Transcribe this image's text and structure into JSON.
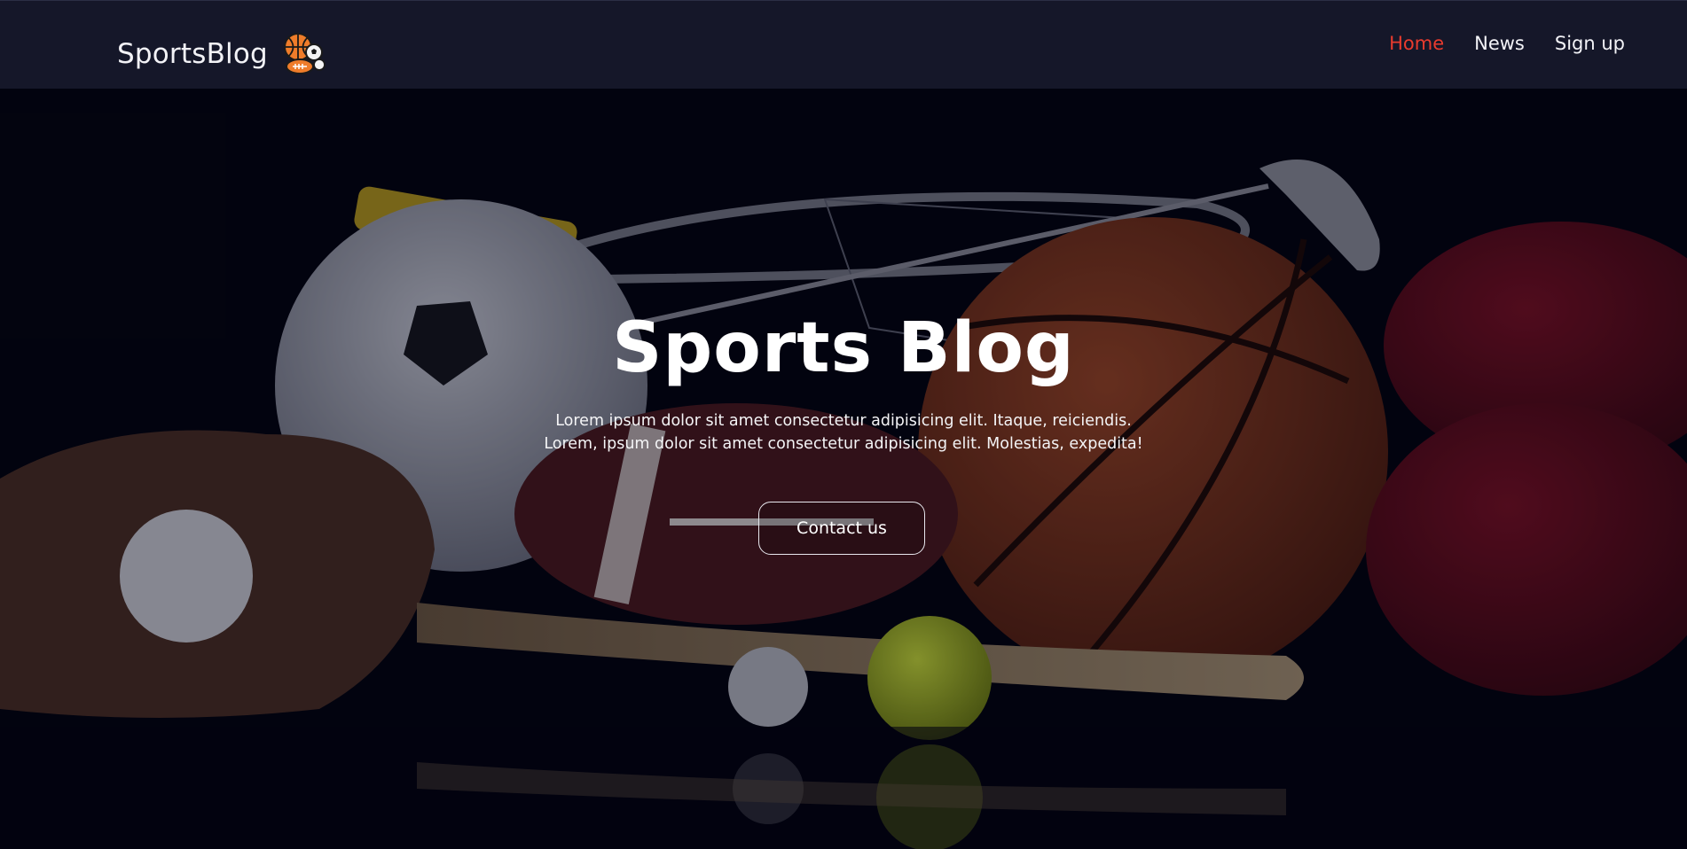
{
  "navbar": {
    "brand": "SportsBlog",
    "links": [
      {
        "label": "Home",
        "active": true
      },
      {
        "label": "News",
        "active": false
      },
      {
        "label": "Sign up",
        "active": false
      }
    ]
  },
  "hero": {
    "title": "Sports Blog",
    "line1": "Lorem ipsum dolor sit amet consectetur adipisicing elit. Itaque, reiciendis.",
    "line2": "Lorem, ipsum dolor sit amet consectetur adipisicing elit. Molestias, expedita!",
    "cta": "Contact us"
  },
  "colors": {
    "nav_bg": "#151729",
    "accent": "#ea3b2e",
    "hero_bg": "#02030d"
  },
  "icons": {
    "brand_logo": "sports-balls-icon"
  }
}
